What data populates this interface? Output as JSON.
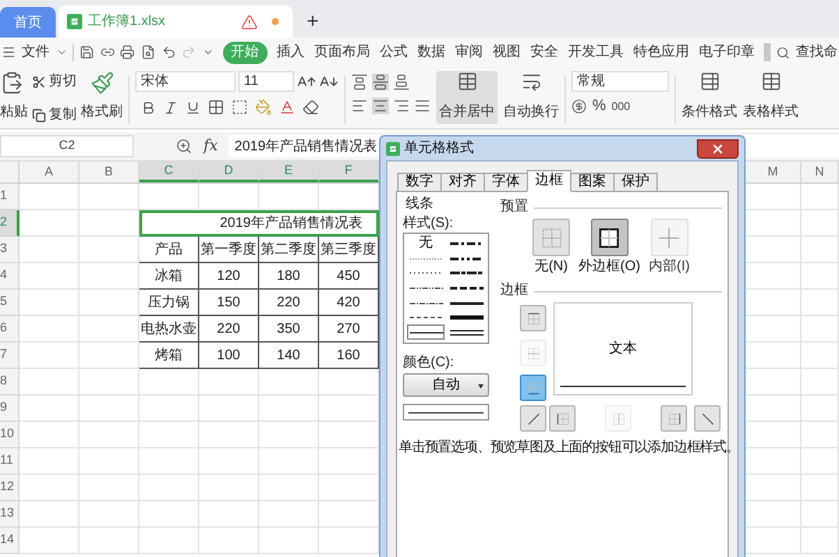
{
  "tabbar": {
    "tabs": [
      {
        "label": "首页",
        "kind": "home",
        "selected": false
      },
      {
        "label": "工作簿1.xlsx",
        "kind": "file",
        "selected": true
      }
    ],
    "new_tab": "+"
  },
  "menu": {
    "file": "文件",
    "tabs": [
      {
        "label": "开始",
        "selected": true
      },
      {
        "label": "插入",
        "selected": false
      },
      {
        "label": "页面布局",
        "selected": false
      },
      {
        "label": "公式",
        "selected": false
      },
      {
        "label": "数据",
        "selected": false
      },
      {
        "label": "审阅",
        "selected": false
      },
      {
        "label": "视图",
        "selected": false
      },
      {
        "label": "安全",
        "selected": false
      },
      {
        "label": "开发工具",
        "selected": false
      },
      {
        "label": "特色应用",
        "selected": false
      },
      {
        "label": "电子印章",
        "selected": false
      }
    ],
    "search": "查找命"
  },
  "ribbon": {
    "paste": "粘贴",
    "cut": "剪切",
    "copy": "复制",
    "format_painter": "格式刷",
    "font": "宋体",
    "font_size": "11",
    "merge": "合并居中",
    "wrap": "自动换行",
    "number_format": "常规",
    "percent": "%",
    "thousands": "000",
    "conditional": "条件格式",
    "table_style": "表格样式"
  },
  "formula_bar": {
    "cell": "C2",
    "fx": "fx",
    "value": "2019年产品销售情况表"
  },
  "sheet": {
    "columns": [
      {
        "label": "A",
        "selected": false
      },
      {
        "label": "B",
        "selected": false
      },
      {
        "label": "C",
        "selected": true
      },
      {
        "label": "D",
        "selected": true
      },
      {
        "label": "E",
        "selected": true
      },
      {
        "label": "F",
        "selected": true
      },
      {
        "label": "M",
        "selected": false
      },
      {
        "label": "N",
        "selected": false
      }
    ],
    "rows": [
      {
        "label": "1",
        "selected": false
      },
      {
        "label": "2",
        "selected": true
      },
      {
        "label": "3",
        "selected": false
      },
      {
        "label": "4",
        "selected": false
      },
      {
        "label": "5",
        "selected": false
      },
      {
        "label": "6",
        "selected": false
      },
      {
        "label": "7",
        "selected": false
      },
      {
        "label": "8",
        "selected": false
      },
      {
        "label": "9",
        "selected": false
      },
      {
        "label": "10",
        "selected": false
      },
      {
        "label": "11",
        "selected": false
      },
      {
        "label": "12",
        "selected": false
      },
      {
        "label": "13",
        "selected": false
      },
      {
        "label": "14",
        "selected": false
      }
    ],
    "table": {
      "title": "2019年产品销售情况表",
      "header": [
        "产品",
        "第一季度",
        "第二季度",
        "第三季度"
      ],
      "rows": [
        [
          "冰箱",
          "120",
          "180",
          "450"
        ],
        [
          "压力锅",
          "150",
          "220",
          "420"
        ],
        [
          "电热水壶",
          "220",
          "350",
          "270"
        ],
        [
          "烤箱",
          "100",
          "140",
          "160"
        ]
      ]
    }
  },
  "dialog": {
    "title": "单元格格式",
    "tabs": [
      {
        "label": "数字",
        "selected": false
      },
      {
        "label": "对齐",
        "selected": false
      },
      {
        "label": "字体",
        "selected": false
      },
      {
        "label": "边框",
        "selected": true
      },
      {
        "label": "图案",
        "selected": false
      },
      {
        "label": "保护",
        "selected": false
      }
    ],
    "line_group": "线条",
    "style_label": "样式(S):",
    "styles": [
      {
        "kind": "none",
        "label": "无",
        "selected": false
      },
      {
        "kind": "medium-dash-dot",
        "selected": false
      },
      {
        "kind": "hair",
        "selected": false
      },
      {
        "kind": "medium-dash-dot-dot",
        "selected": false
      },
      {
        "kind": "dotted",
        "selected": false
      },
      {
        "kind": "slanted-dash-dot",
        "selected": false
      },
      {
        "kind": "dash-dot-dot",
        "selected": false
      },
      {
        "kind": "medium-dashed",
        "selected": false
      },
      {
        "kind": "dash-dot",
        "selected": false
      },
      {
        "kind": "medium",
        "selected": false
      },
      {
        "kind": "dashed",
        "selected": false
      },
      {
        "kind": "thick",
        "selected": false
      },
      {
        "kind": "thin",
        "selected": true
      },
      {
        "kind": "double",
        "selected": false
      }
    ],
    "color_label": "颜色(C):",
    "color_value": "自动",
    "preset_group": "预置",
    "presets": [
      {
        "kind": "none",
        "label": "无(N)",
        "selected": false,
        "disabled": false
      },
      {
        "kind": "outline",
        "label": "外边框(O)",
        "selected": true,
        "disabled": false
      },
      {
        "kind": "inside",
        "label": "内部(I)",
        "selected": false,
        "disabled": true
      }
    ],
    "border_group": "边框",
    "side_buttons": [
      {
        "kind": "top",
        "selected": false,
        "disabled": false
      },
      {
        "kind": "middle",
        "selected": false,
        "disabled": true
      },
      {
        "kind": "bottom",
        "selected": true,
        "disabled": false
      }
    ],
    "bottom_buttons": [
      {
        "kind": "diagonal-up",
        "selected": false,
        "disabled": false
      },
      {
        "kind": "left",
        "selected": false,
        "disabled": false
      },
      {
        "kind": "center",
        "selected": false,
        "disabled": true
      },
      {
        "kind": "right",
        "selected": false,
        "disabled": false
      },
      {
        "kind": "diagonal-down",
        "selected": false,
        "disabled": false
      }
    ],
    "preview_text": "文本",
    "hint": "单击预置选项、预览草图及上面的按钮可以添加边框样式。"
  }
}
